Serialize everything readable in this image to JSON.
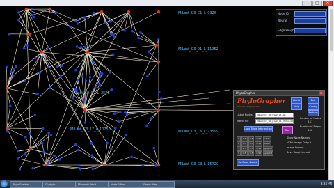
{
  "labels": {
    "l1": "MiLast_C3_C1_L_0326",
    "l2": "MiLast_C3_01_L_11952",
    "l3": "MiLast_C3_07_L_2573",
    "l4": "MiLast_C3_17_L_10750",
    "l5": "MiLast_C3_C6_L_23599",
    "l6": "MiLast_C3_C3_L_15720"
  },
  "topbox": {
    "row1": "Node ID",
    "row2": "Neural",
    "row3": "Edge Weight"
  },
  "panel": {
    "title": "PhytoGrapher",
    "logo": "PhyloGrapher",
    "logo_sub": "Genomic Fingerprints",
    "btn_about": "About",
    "btn_help": "Help",
    "btn_exit": "Exit",
    "btn_config": "Config",
    "btn_redraw": "Redraw",
    "file_nodes_label": "List of Nodes",
    "file_nodes_value": "MiLast_C3_Nt_graph_01.dat",
    "file_edges_label": "Matrix file",
    "file_edges_value": "MiLast_C3_Nt_graph_01_Matrix.dat",
    "stats_nodes_label": "Number of Nodes",
    "stats_nodes_value": "117",
    "stats_edges_label": "Number of Edges",
    "stats_edges_value": "118",
    "load_btn": "Load Table Information",
    "run_btn": "Run",
    "table_rows": [
      [
        "1",
        "0.5",
        "0.5",
        "0.56",
        "state"
      ],
      [
        "2",
        "0.5",
        "0.5",
        "0.56",
        "state"
      ],
      [
        "3",
        "0.5",
        "0.5",
        "0.56",
        "graphB"
      ],
      [
        "4",
        "0.5",
        "0.5",
        "0.56",
        "graphB"
      ]
    ],
    "right_lbl1": "Show Node Names",
    "right_lbl2": "HTML Image Output",
    "right_lbl3": "Image Format",
    "right_lbl4": "Save Graph Layout",
    "bottom_btn": "Re-Color Nodes"
  },
  "taskbar": {
    "tasks": [
      "PhytoGrapher",
      "C:\\phylo",
      "Microsoft Word",
      "Node Editor",
      "Graph View"
    ],
    "clock": "3:33 PM"
  },
  "colors": {
    "node": "#1f3fe0",
    "hub": "#e0341f",
    "edge": "#f4ead2",
    "label": "#35c8ff"
  }
}
